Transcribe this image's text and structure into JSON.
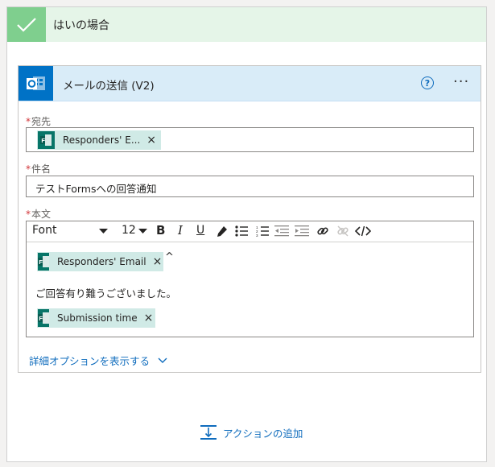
{
  "condition": {
    "title": "はいの場合"
  },
  "action": {
    "title": "メールの送信 (V2)",
    "help_label": "?",
    "more_label": "···"
  },
  "to_field": {
    "label": "宛先",
    "required_mark": "*",
    "token": {
      "label": "Responders' E...",
      "close": "×"
    }
  },
  "subject_field": {
    "label": "件名",
    "required_mark": "*",
    "value": "テストFormsへの回答通知"
  },
  "body_field": {
    "label": "本文",
    "required_mark": "*",
    "toolbar": {
      "font_label": "Font",
      "size_label": "12",
      "bold": "B",
      "italic": "I",
      "underline": "U"
    },
    "token1": {
      "label": "Responders' Email",
      "close": "×"
    },
    "caret": "^",
    "text": "ご回答有り難うございました。",
    "token2": {
      "label": "Submission time",
      "close": "×"
    }
  },
  "advanced_options": {
    "label": "詳細オプションを表示する"
  },
  "add_action": {
    "label": "アクションの追加"
  },
  "colors": {
    "condition_bg": "#e5f5e8",
    "check_bg": "#7fcf8e",
    "header_bg": "#d9ecf8",
    "outlook_blue": "#0072c6",
    "token_bg": "#d0eae6",
    "forms_teal": "#077568",
    "link_blue": "#0f6cbd",
    "required_red": "#d13438"
  },
  "icons": [
    "checkmark-icon",
    "outlook-icon",
    "help-icon",
    "more-icon",
    "forms-icon",
    "close-icon",
    "bold-icon",
    "italic-icon",
    "underline-icon",
    "highlight-icon",
    "bullet-list-icon",
    "numbered-list-icon",
    "outdent-icon",
    "indent-icon",
    "link-icon",
    "unlink-icon",
    "code-icon",
    "chevron-down-icon",
    "add-action-icon"
  ]
}
